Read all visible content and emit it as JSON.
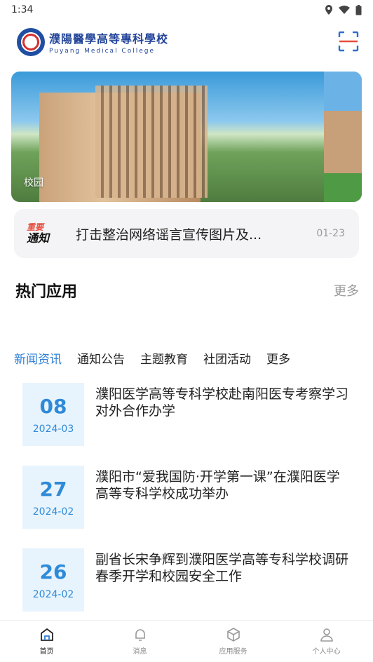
{
  "status_bar": {
    "time": "1:34"
  },
  "header": {
    "school_name_cn": "濮陽醫學高等專科學校",
    "school_name_en": "Puyang Medical College"
  },
  "banner": {
    "label": "校园"
  },
  "notice": {
    "badge_top": "重要",
    "badge_bottom": "通知",
    "text": "打击整治网络谣言宣传图片及...",
    "date": "01-23"
  },
  "hot_apps": {
    "title": "热门应用",
    "more": "更多"
  },
  "tabs": [
    "新闻资讯",
    "通知公告",
    "主题教育",
    "社团活动",
    "更多"
  ],
  "news": [
    {
      "day": "08",
      "ym": "2024-03",
      "title": "濮阳医学高等专科学校赴南阳医专考察学习对外合作办学"
    },
    {
      "day": "27",
      "ym": "2024-02",
      "title": "濮阳市“爱我国防·开学第一课”在濮阳医学高等专科学校成功举办"
    },
    {
      "day": "26",
      "ym": "2024-02",
      "title": "副省长宋争辉到濮阳医学高等专科学校调研春季开学和校园安全工作"
    }
  ],
  "bottom_nav": [
    "首页",
    "消息",
    "应用服务",
    "个人中心"
  ],
  "colors": {
    "accent": "#2f7fd6",
    "date_bg": "#e8f4fd",
    "notice_bg": "#f4f4f6"
  }
}
